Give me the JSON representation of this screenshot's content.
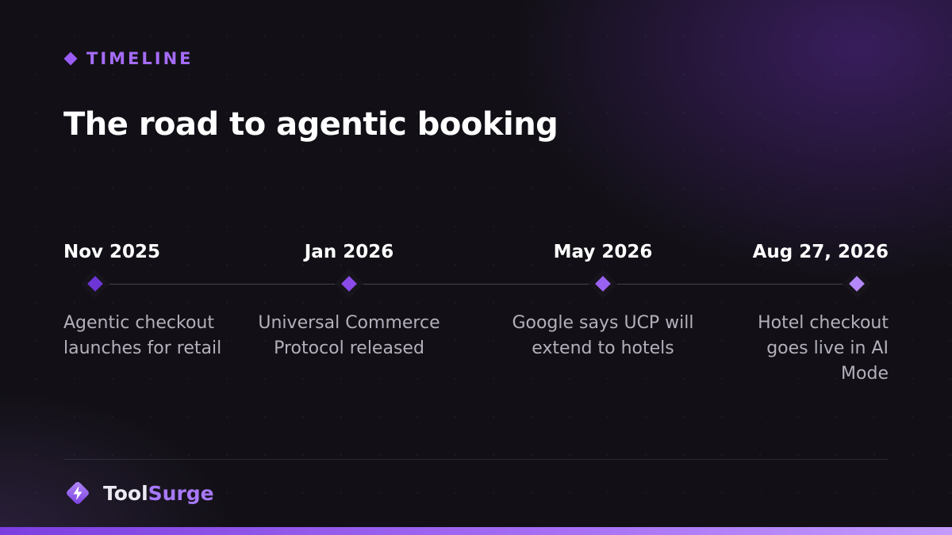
{
  "eyebrow": {
    "icon": "diamond-icon",
    "label": "TIMELINE",
    "color": "#9b5cf6"
  },
  "title": "The road to agentic booking",
  "timeline": {
    "milestones": [
      {
        "date": "Nov 2025",
        "description": "Agentic checkout launches for retail",
        "node_color": "#6d35d6"
      },
      {
        "date": "Jan 2026",
        "description": "Universal Commerce Protocol released",
        "node_color": "#8a4be8"
      },
      {
        "date": "May 2026",
        "description": "Google says UCP will extend to hotels",
        "node_color": "#9a62f0"
      },
      {
        "date": "Aug 27, 2026",
        "description": "Hotel checkout goes live in AI Mode",
        "node_color": "#b488f8"
      }
    ]
  },
  "brand": {
    "icon": "lightning-bolt-icon",
    "name_part1": "Tool",
    "name_part2": "Surge",
    "accent": "#a779f8"
  }
}
